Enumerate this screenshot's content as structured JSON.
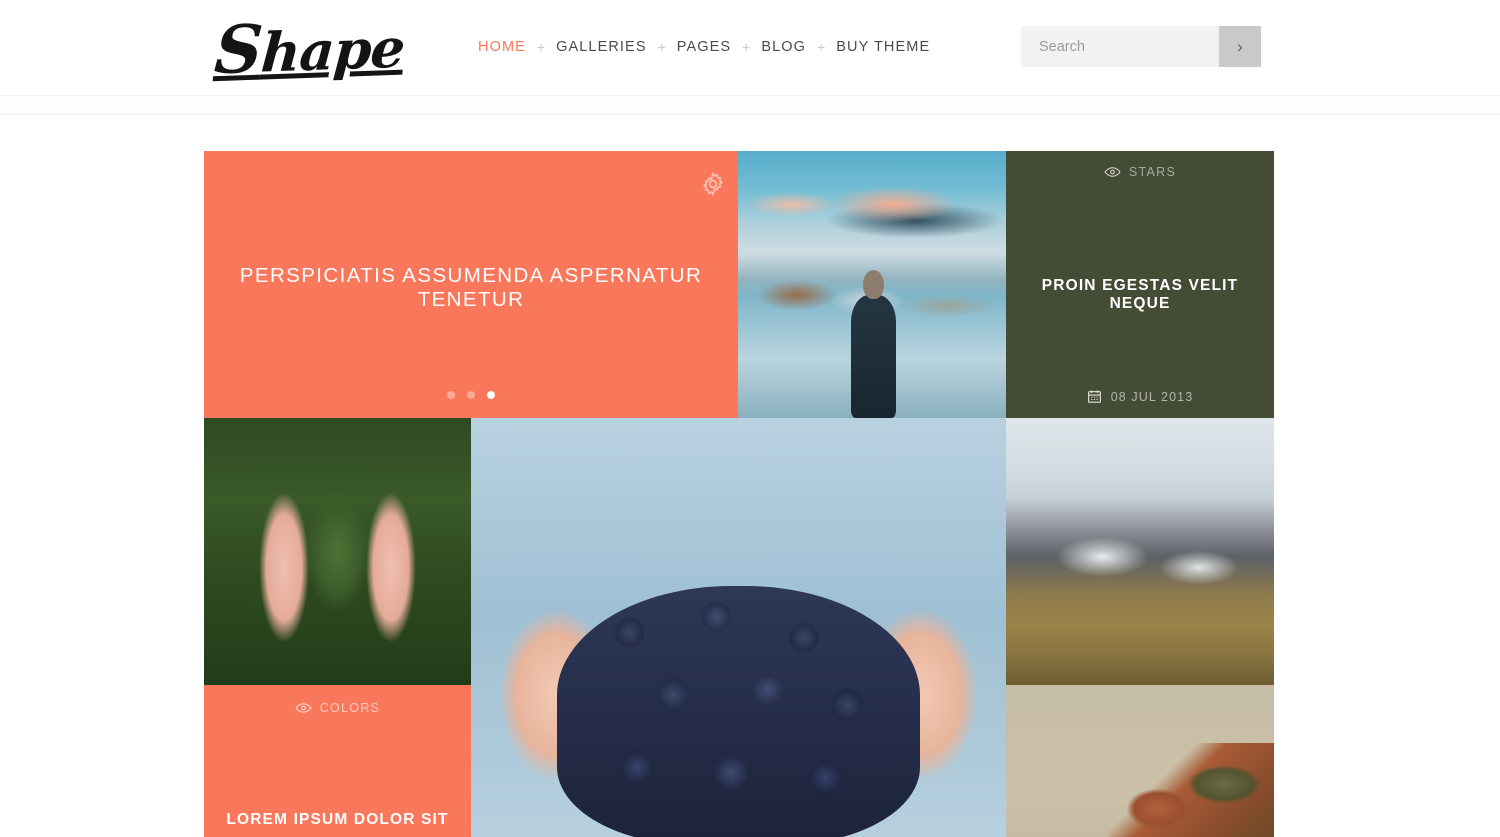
{
  "site": {
    "logo_text": "Shape",
    "logo_initial": "S",
    "logo_rest": "hape"
  },
  "nav": {
    "separator": "+",
    "items": [
      {
        "label": "HOME",
        "active": true
      },
      {
        "label": "GALLERIES",
        "active": false
      },
      {
        "label": "PAGES",
        "active": false
      },
      {
        "label": "BLOG",
        "active": false
      },
      {
        "label": "BUY THEME",
        "active": false
      }
    ]
  },
  "search": {
    "placeholder": "Search",
    "value": "",
    "submit_icon": "chevron-right-icon",
    "submit_glyph": "›"
  },
  "grid": {
    "slider_tile": {
      "title": "PERSPICIATIS ASSUMENDA ASPERNATUR TENETUR",
      "icon": "gear-icon",
      "background_color": "#f9775a",
      "dots": [
        {
          "active": false
        },
        {
          "active": false
        },
        {
          "active": true
        }
      ]
    },
    "tiles": [
      {
        "name": "lake-photo",
        "type": "photo",
        "description": "person in dark puffer jacket facing mountain lake at sunset"
      },
      {
        "name": "stars-tile",
        "type": "color",
        "background_color": "#454c35",
        "category_icon": "eye-icon",
        "category": "STARS",
        "title": "PROIN EGESTAS VELIT NEQUE",
        "date_icon": "calendar-icon",
        "date": "08 JUL 2013"
      },
      {
        "name": "fir-photo",
        "type": "photo",
        "description": "hands holding green fir needles over grass"
      },
      {
        "name": "grapes-photo",
        "type": "photo",
        "description": "hands holding a large cluster of dark blue grapes"
      },
      {
        "name": "mountain-photo",
        "type": "photo",
        "description": "snow dusted mountain ridge under overcast sky"
      },
      {
        "name": "colors-tile",
        "type": "color",
        "background_color": "#f9775a",
        "category_icon": "eye-icon",
        "category": "COLORS",
        "title": "LOREM IPSUM DOLOR SIT"
      },
      {
        "name": "rust-photo",
        "type": "photo",
        "description": "rusted shipwreck metal against pale tan sky"
      }
    ]
  },
  "colors": {
    "accent": "#f9775a",
    "olive": "#454c35",
    "text_dark": "#4a4a4a",
    "search_bg": "#f2f2f2",
    "search_button_bg": "#c9c9c9"
  }
}
